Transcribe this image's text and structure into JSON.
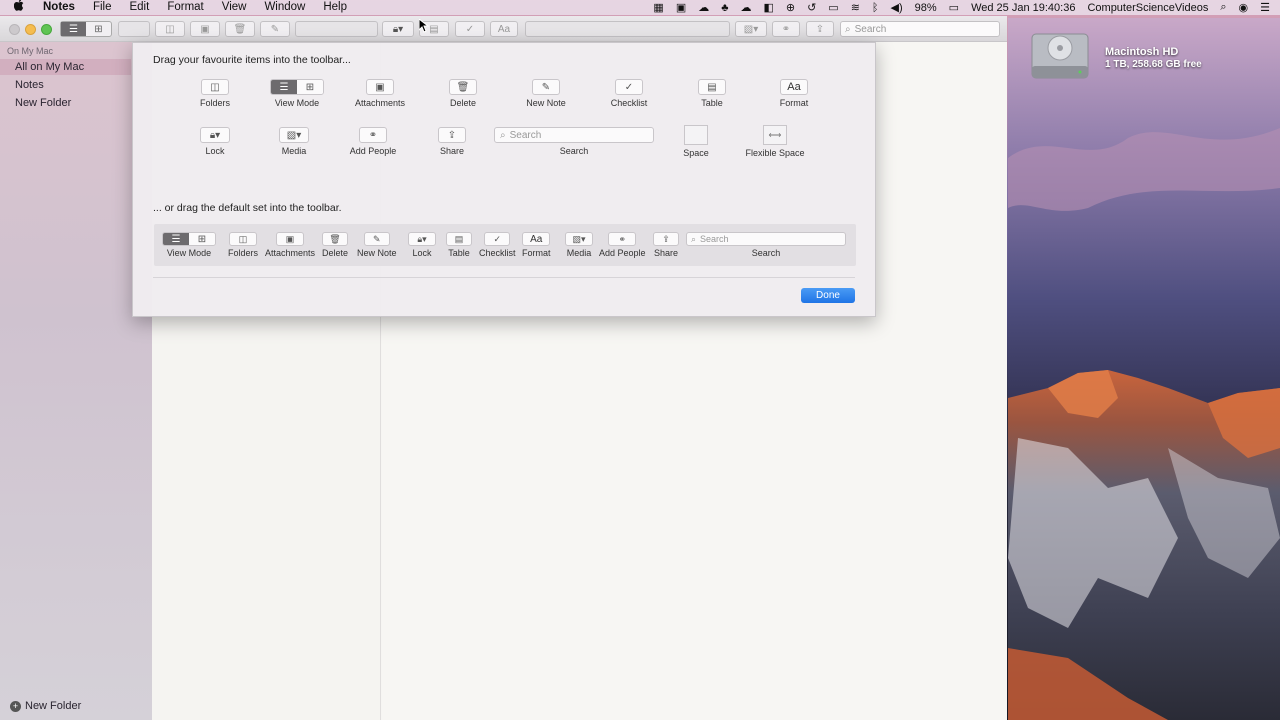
{
  "menubar": {
    "apple": "",
    "items": [
      "Notes",
      "File",
      "Edit",
      "Format",
      "View",
      "Window",
      "Help"
    ],
    "status": {
      "battery": "98%",
      "datetime": "Wed 25 Jan  19:40:36",
      "user": "ComputerScienceVideos"
    }
  },
  "desktop": {
    "drive_name": "Macintosh HD",
    "drive_info": "1 TB, 258.68 GB free"
  },
  "window": {
    "toolbar": {
      "search_placeholder": "Search",
      "format_label": "Aa"
    },
    "sidebar": {
      "header": "On My Mac",
      "items": [
        "All on My Mac",
        "Notes",
        "New Folder"
      ],
      "selected_index": 0,
      "new_folder_button": "New Folder"
    }
  },
  "sheet": {
    "drag_title": "Drag your favourite items into the toolbar...",
    "default_title": "... or drag the default set into the toolbar.",
    "palette_row1": [
      "Folders",
      "View Mode",
      "Attachments",
      "Delete",
      "New Note",
      "Checklist",
      "Table",
      "Format"
    ],
    "palette_row2": [
      "Lock",
      "Media",
      "Add People",
      "Share",
      "Search",
      "Space",
      "Flexible Space"
    ],
    "search_placeholder": "Search",
    "format_glyph": "Aa",
    "default_set": [
      "View Mode",
      "Folders",
      "Attachments",
      "Delete",
      "New Note",
      "Lock",
      "Table",
      "Checklist",
      "Format",
      "Media",
      "Add People",
      "Share",
      "Search"
    ],
    "done_label": "Done"
  }
}
